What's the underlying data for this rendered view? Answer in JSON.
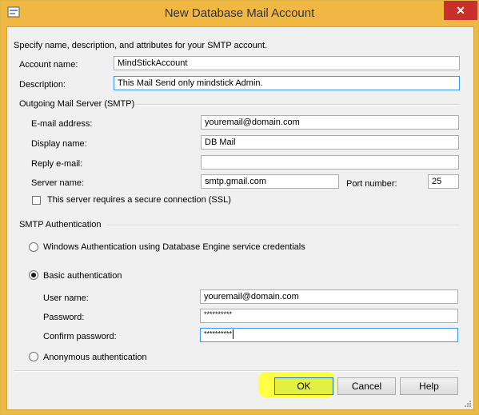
{
  "window": {
    "title": "New Database Mail Account",
    "close_glyph": "✕"
  },
  "intro_text": "Specify name, description, and attributes for your SMTP account.",
  "account": {
    "name_label": "Account name:",
    "name_value": "MindStickAccount",
    "description_label": "Description:",
    "description_value": "This Mail Send only mindstick Admin."
  },
  "outgoing_server": {
    "group_label": "Outgoing Mail Server (SMTP)",
    "email_label": "E-mail address:",
    "email_value": "youremail@domain.com",
    "display_name_label": "Display name:",
    "display_name_value": "DB Mail",
    "reply_email_label": "Reply e-mail:",
    "reply_email_value": "",
    "server_name_label": "Server name:",
    "server_name_value": "smtp.gmail.com",
    "port_label": "Port number:",
    "port_value": "25",
    "ssl_label": "This server requires a secure connection (SSL)",
    "ssl_checked": false
  },
  "smtp_auth": {
    "group_label": "SMTP Authentication",
    "windows_auth_label": "Windows Authentication using Database Engine service credentials",
    "basic_auth_label": "Basic authentication",
    "selected": "basic",
    "username_label": "User name:",
    "username_value": "youremail@domain.com",
    "password_label": "Password:",
    "password_value": "**********",
    "confirm_password_label": "Confirm password:",
    "confirm_password_value": "**********",
    "anonymous_label": "Anonymous authentication"
  },
  "buttons": {
    "ok": "OK",
    "cancel": "Cancel",
    "help": "Help"
  },
  "colors": {
    "title_bar": "#f0b742",
    "close_button": "#c7302b",
    "ok_highlight": "#ffff3a",
    "focus_border": "#3399ff"
  }
}
